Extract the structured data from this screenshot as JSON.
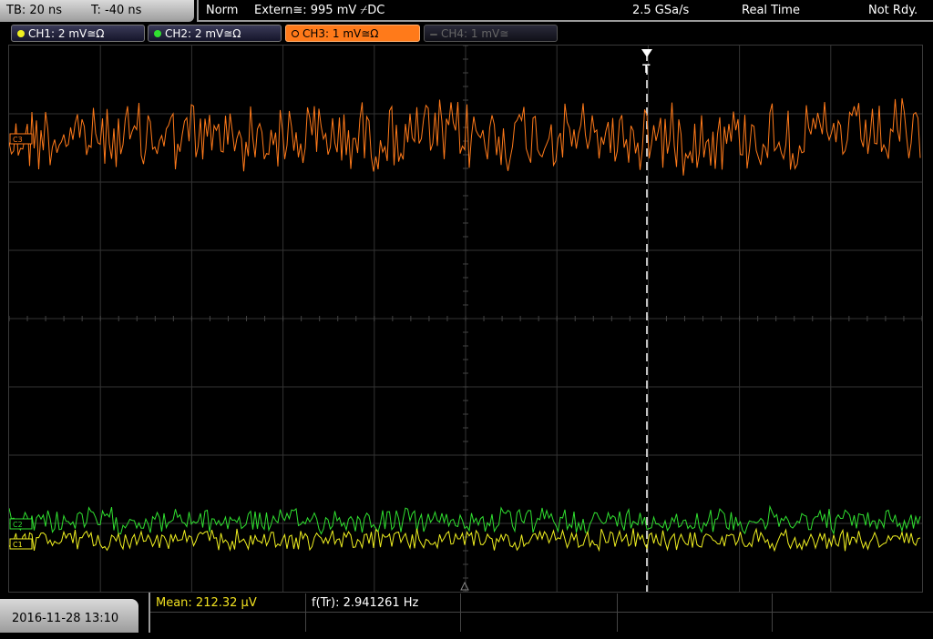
{
  "topbar": {
    "timebase": "TB: 20 ns",
    "trigger_time": "T: -40 ns",
    "mode": "Norm",
    "trigger_source": "Extern≅: 995 mV ⌿DC",
    "sample_rate": "2.5 GSa/s",
    "acq_mode": "Real Time",
    "status": "Not Rdy."
  },
  "channels": [
    {
      "label": "CH1: 2 mV≅Ω",
      "color": "#f0e020",
      "active": true
    },
    {
      "label": "CH2: 2 mV≅Ω",
      "color": "#30e030",
      "active": true
    },
    {
      "label": "CH3: 1 mV≅Ω",
      "color": "#ff7a1a",
      "active": true,
      "selected": true
    },
    {
      "label": "CH4: 1 mV≅",
      "color": "#555555",
      "active": false
    }
  ],
  "markers": {
    "trigger_marker": "T",
    "ch3_marker": "C3",
    "ch2_marker": "C2",
    "ch1_marker": "C1"
  },
  "measurements": {
    "mean": "Mean: 212.32 µV",
    "freq": "f(Tr): 2.941261 Hz"
  },
  "datetime": "2016-11-28 13:10",
  "colors": {
    "ch1": "#f0f020",
    "ch2": "#30e030",
    "ch3": "#ff7a1a",
    "grid": "#333333",
    "trigger_line": "#ffffff"
  }
}
